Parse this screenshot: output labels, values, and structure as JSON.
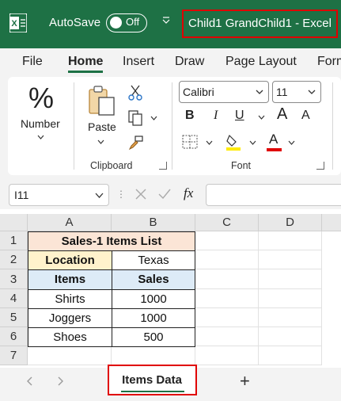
{
  "titlebar": {
    "autosave_label": "AutoSave",
    "autosave_state": "Off",
    "title": "Child1 GrandChild1  -  Excel",
    "app_icon": "excel-logo-icon"
  },
  "tabs": [
    "File",
    "Home",
    "Insert",
    "Draw",
    "Page Layout",
    "Form"
  ],
  "active_tab": "Home",
  "ribbon": {
    "number_label": "Number",
    "paste_label": "Paste",
    "clipboard_label": "Clipboard",
    "font_group_label": "Font",
    "font_name": "Calibri",
    "font_size": "11",
    "bold": "B",
    "italic": "I",
    "underline": "U",
    "grow": "A",
    "shrink": "A",
    "font_color": "A",
    "number_glyph": "%"
  },
  "formula_bar": {
    "name_box": "I11",
    "fx": "fx",
    "value": ""
  },
  "sheet": {
    "columns": [
      "A",
      "B",
      "C",
      "D"
    ],
    "rows": [
      "1",
      "2",
      "3",
      "4",
      "5",
      "6",
      "7"
    ],
    "title": "Sales-1 Items List",
    "location_label": "Location",
    "location_value": "Texas",
    "header_items": "Items",
    "header_sales": "Sales",
    "data": [
      {
        "item": "Shirts",
        "sales": "1000"
      },
      {
        "item": "Joggers",
        "sales": "1000"
      },
      {
        "item": "Shoes",
        "sales": "500"
      }
    ],
    "colors": {
      "title_fill": "#fbe5d6",
      "location_fill": "#fff2cc",
      "header_fill": "#ddebf7",
      "accent": "#1e7145",
      "highlight_border": "#e00000"
    }
  },
  "sheet_tabs": {
    "active": "Items Data",
    "add": "+",
    "prev": "‹",
    "next": "›"
  }
}
